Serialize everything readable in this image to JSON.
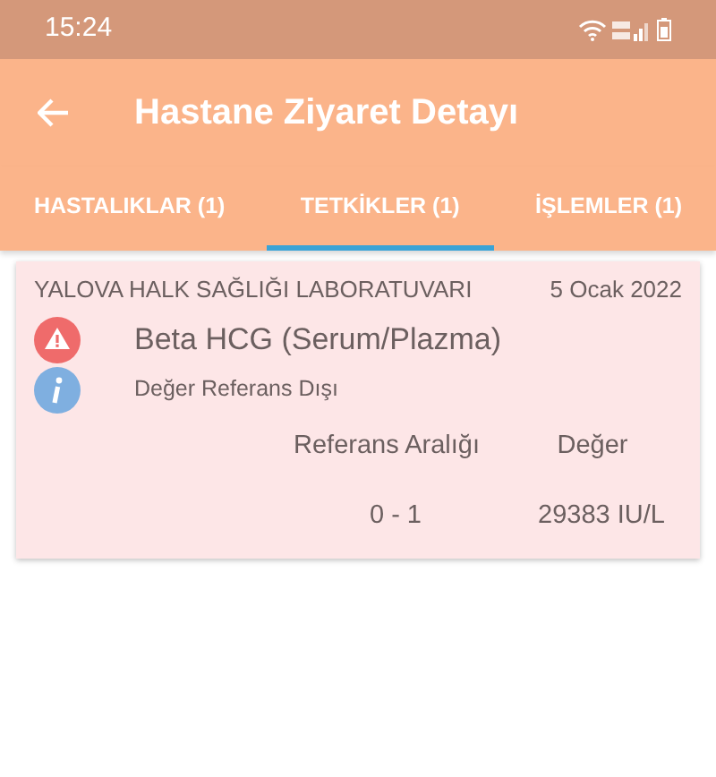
{
  "status_bar": {
    "time": "15:24"
  },
  "app_bar": {
    "title": "Hastane Ziyaret Detayı"
  },
  "tabs": [
    {
      "label": "HASTALIKLAR (1)",
      "selected": false
    },
    {
      "label": "TETKİKLER (1)",
      "selected": true
    },
    {
      "label": "İŞLEMLER (1)",
      "selected": false
    }
  ],
  "results": [
    {
      "lab": "YALOVA HALK SAĞLIĞI LABORATUVARI",
      "date": "5 Ocak 2022",
      "test": "Beta HCG (Serum/Plazma)",
      "note": "Değer Referans Dışı",
      "out_of_range": true,
      "range_header": "Referans Aralığı",
      "value_header": "Değer",
      "range": "0 - 1",
      "value": "29383 IU/L"
    }
  ]
}
